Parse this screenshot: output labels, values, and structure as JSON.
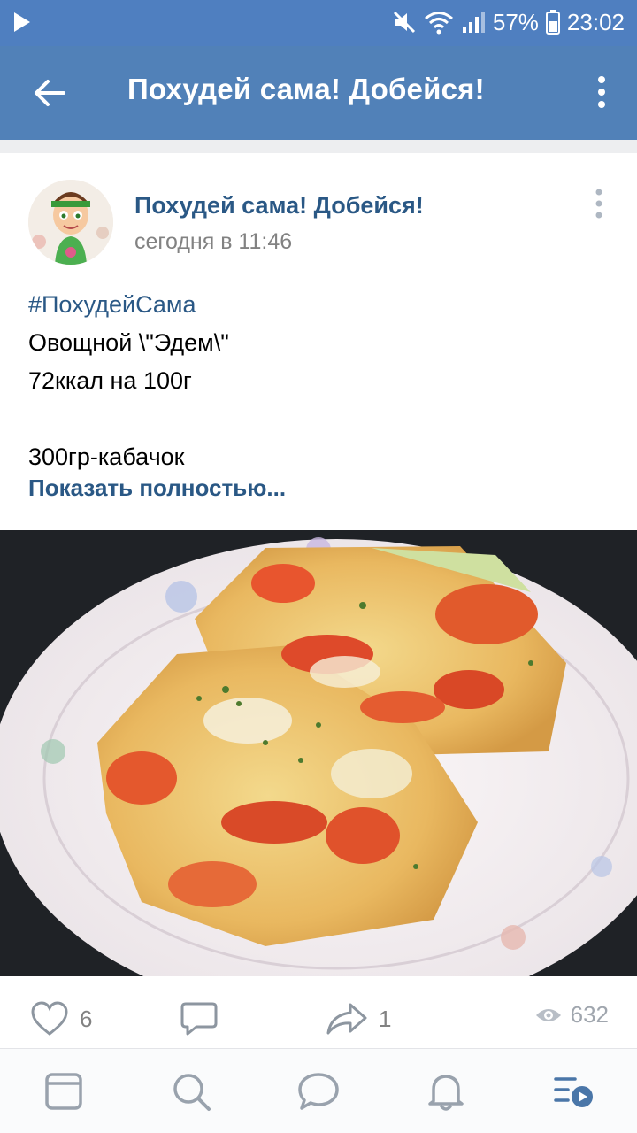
{
  "status_bar": {
    "battery_percent": "57%",
    "time": "23:02"
  },
  "app_bar": {
    "title": "Похудей сама! Добейся!"
  },
  "post": {
    "author": "Похудей сама! Добейся!",
    "time": "сегодня в 11:46",
    "hashtag": "#ПохудейСама",
    "lines": [
      "Овощной \\\"Эдем\\\"",
      "72ккал на 100г",
      "",
      "300гр-кабачок"
    ],
    "show_more": "Показать полностью...",
    "likes": "6",
    "shares": "1",
    "views": "632"
  },
  "colors": {
    "header_bg": "#5181b8",
    "link": "#2a5885"
  },
  "icons": [
    "play-icon",
    "mute-icon",
    "wifi-icon",
    "signal-icon",
    "battery-icon",
    "back-arrow-icon",
    "more-vertical-icon",
    "heart-icon",
    "comment-icon",
    "share-icon",
    "eye-icon",
    "news-icon",
    "search-icon",
    "messages-icon",
    "bell-icon",
    "feed-video-icon"
  ]
}
